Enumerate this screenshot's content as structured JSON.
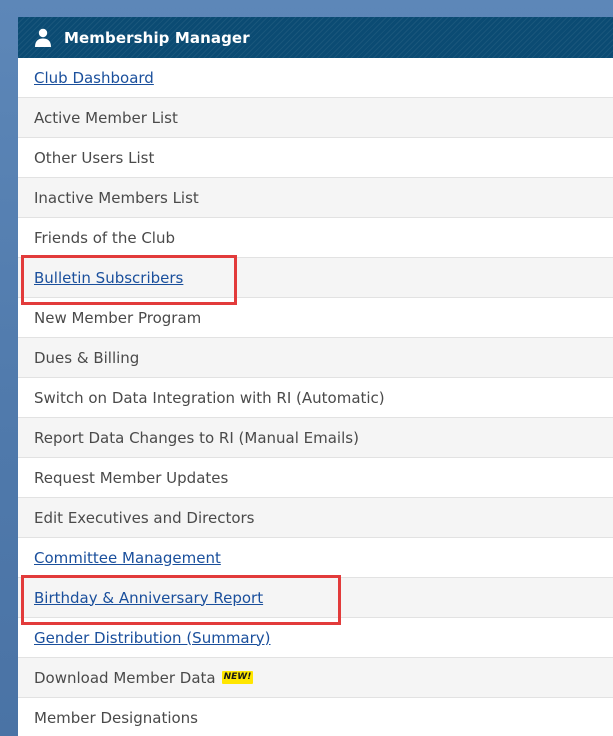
{
  "header": {
    "title": "Membership Manager",
    "icon": "user-icon"
  },
  "menu": {
    "items": [
      {
        "label": "Club Dashboard",
        "link": true
      },
      {
        "label": "Active Member List",
        "link": false
      },
      {
        "label": "Other Users List",
        "link": false
      },
      {
        "label": "Inactive Members List",
        "link": false
      },
      {
        "label": "Friends of the Club",
        "link": false
      },
      {
        "label": "Bulletin Subscribers",
        "link": true,
        "highlighted": true
      },
      {
        "label": "New Member Program",
        "link": false
      },
      {
        "label": "Dues & Billing",
        "link": false
      },
      {
        "label": "Switch on Data Integration with RI (Automatic)",
        "link": false
      },
      {
        "label": "Report Data Changes to RI (Manual Emails)",
        "link": false
      },
      {
        "label": "Request Member Updates",
        "link": false
      },
      {
        "label": "Edit Executives and Directors",
        "link": false
      },
      {
        "label": "Committee Management",
        "link": true
      },
      {
        "label": "Birthday & Anniversary Report",
        "link": true,
        "highlighted": true
      },
      {
        "label": "Gender Distribution (Summary)",
        "link": true
      },
      {
        "label": "Download Member Data",
        "link": false,
        "badge": "NEW!"
      },
      {
        "label": "Member Designations",
        "link": false
      }
    ]
  },
  "colors": {
    "header_bg": "#0b4b73",
    "link": "#1a4f9c",
    "highlight_border": "#e23b3b",
    "badge_bg": "#ffe600"
  }
}
